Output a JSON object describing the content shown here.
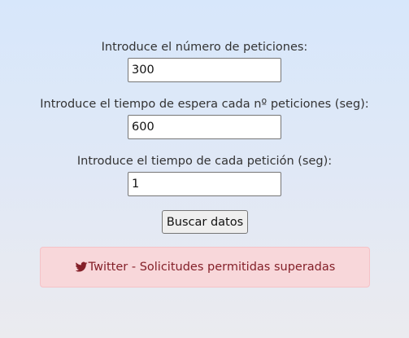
{
  "form": {
    "requests_label": "Introduce el número de peticiones:",
    "requests_value": "300",
    "wait_label": "Introduce el tiempo de espera cada nº peticiones (seg):",
    "wait_value": "600",
    "request_time_label": "Introduce el tiempo de cada petición (seg):",
    "request_time_value": "1",
    "submit_label": "Buscar datos"
  },
  "alert": {
    "icon": "twitter-icon",
    "text": "Twitter - Solicitudes permitidas superadas",
    "color": "#842029",
    "background": "#f8d7da"
  }
}
